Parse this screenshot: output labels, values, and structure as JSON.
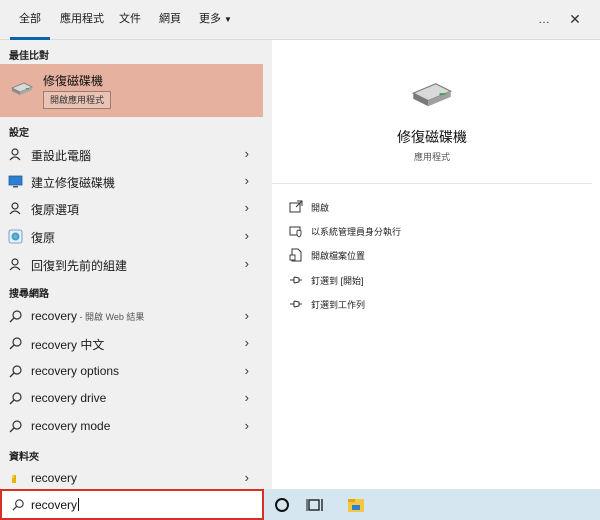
{
  "tabs": [
    {
      "label": "全部",
      "active": true
    },
    {
      "label": "應用程式"
    },
    {
      "label": "文件"
    },
    {
      "label": "網頁"
    },
    {
      "label": "更多"
    }
  ],
  "top_icons": {
    "more": "…",
    "close": "✕"
  },
  "sections": {
    "best_match": "最佳比對",
    "settings": "設定",
    "web": "搜尋網路",
    "folders": "資料夾"
  },
  "best_match": {
    "title": "修復磁碟機",
    "open_label": "開啟應用程式"
  },
  "settings_items": [
    {
      "label": "重設此電腦",
      "icon": "person-reset-icon"
    },
    {
      "label": "建立修復磁碟機",
      "icon": "monitor-icon"
    },
    {
      "label": "復原選項",
      "icon": "person-icon"
    },
    {
      "label": "復原",
      "icon": "control-panel-icon"
    },
    {
      "label": "回復到先前的組建",
      "icon": "person-icon"
    }
  ],
  "web_items": [
    {
      "label": "recovery",
      "sub": " - 開啟 Web 結果"
    },
    {
      "label": "recovery 中文",
      "sub": ""
    },
    {
      "label": "recovery options",
      "sub": ""
    },
    {
      "label": "recovery drive",
      "sub": ""
    },
    {
      "label": "recovery mode",
      "sub": ""
    }
  ],
  "folder_items": [
    {
      "label": "recovery"
    }
  ],
  "search": {
    "value": "recovery"
  },
  "detail": {
    "title": "修復磁碟機",
    "subtitle": "應用程式",
    "actions": [
      {
        "label": "開啟",
        "icon": "open-icon"
      },
      {
        "label": "以系統管理員身分執行",
        "icon": "shield-icon"
      },
      {
        "label": "開啟檔案位置",
        "icon": "file-location-icon"
      },
      {
        "label": "釘選到 [開始]",
        "icon": "pin-icon"
      },
      {
        "label": "釘選到工作列",
        "icon": "pin-icon"
      }
    ]
  },
  "colors": {
    "accent": "#0a64ad",
    "best_match_bg": "#e6b19f",
    "search_border": "#d93025",
    "taskbar": "#d6e6f0"
  }
}
